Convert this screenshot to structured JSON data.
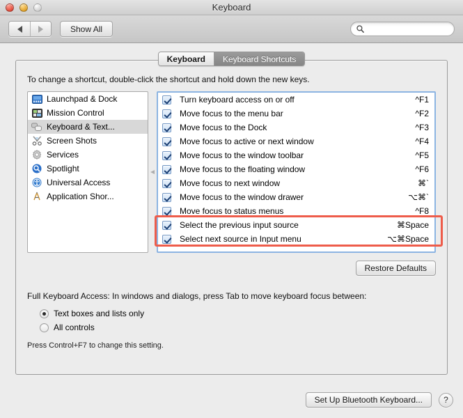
{
  "window": {
    "title": "Keyboard",
    "traffic_lights": [
      "close-button",
      "minimize-button",
      "zoom-button"
    ]
  },
  "toolbar": {
    "back_icon": "back-arrow-icon",
    "forward_icon": "forward-arrow-icon",
    "show_all_label": "Show All",
    "search": {
      "placeholder": "",
      "value": "",
      "icon": "search-icon"
    }
  },
  "tabs": [
    {
      "label": "Keyboard",
      "active": false
    },
    {
      "label": "Keyboard Shortcuts",
      "active": true
    }
  ],
  "content": {
    "instructions": "To change a shortcut, double-click the shortcut and hold down the new keys."
  },
  "sidebar": {
    "items": [
      {
        "label": "Launchpad & Dock",
        "icon": "launchpad-icon",
        "selected": false
      },
      {
        "label": "Mission Control",
        "icon": "mission-control-icon",
        "selected": false
      },
      {
        "label": "Keyboard & Text...",
        "icon": "keyboard-icon",
        "selected": true
      },
      {
        "label": "Screen Shots",
        "icon": "screenshot-icon",
        "selected": false
      },
      {
        "label": "Services",
        "icon": "gear-icon",
        "selected": false
      },
      {
        "label": "Spotlight",
        "icon": "spotlight-icon",
        "selected": false
      },
      {
        "label": "Universal Access",
        "icon": "universal-access-icon",
        "selected": false
      },
      {
        "label": "Application Shor...",
        "icon": "application-shortcuts-icon",
        "selected": false
      }
    ]
  },
  "shortcuts": {
    "rows": [
      {
        "label": "Turn keyboard access on or off",
        "key": "^F1",
        "checked": true,
        "highlighted": false
      },
      {
        "label": "Move focus to the menu bar",
        "key": "^F2",
        "checked": true,
        "highlighted": false
      },
      {
        "label": "Move focus to the Dock",
        "key": "^F3",
        "checked": true,
        "highlighted": false
      },
      {
        "label": "Move focus to active or next window",
        "key": "^F4",
        "checked": true,
        "highlighted": false
      },
      {
        "label": "Move focus to the window toolbar",
        "key": "^F5",
        "checked": true,
        "highlighted": false
      },
      {
        "label": "Move focus to the floating window",
        "key": "^F6",
        "checked": true,
        "highlighted": false
      },
      {
        "label": "Move focus to next window",
        "key": "⌘`",
        "checked": true,
        "highlighted": false
      },
      {
        "label": "Move focus to the window drawer",
        "key": "⌥⌘`",
        "checked": true,
        "highlighted": false
      },
      {
        "label": "Move focus to status menus",
        "key": "^F8",
        "checked": true,
        "highlighted": false
      },
      {
        "label": "Select the previous input source",
        "key": "⌘Space",
        "checked": true,
        "highlighted": true
      },
      {
        "label": "Select next source in Input menu",
        "key": "⌥⌘Space",
        "checked": true,
        "highlighted": true
      }
    ]
  },
  "annotation": {
    "color": "#ee5c4a"
  },
  "restore": {
    "label": "Restore Defaults"
  },
  "full_keyboard_access": {
    "title": "Full Keyboard Access: In windows and dialogs, press Tab to move keyboard focus between:",
    "options": [
      {
        "label": "Text boxes and lists only",
        "selected": true
      },
      {
        "label": "All controls",
        "selected": false
      }
    ],
    "hint": "Press Control+F7 to change this setting."
  },
  "bottom": {
    "bluetooth_label": "Set Up Bluetooth Keyboard...",
    "help_label": "?"
  }
}
